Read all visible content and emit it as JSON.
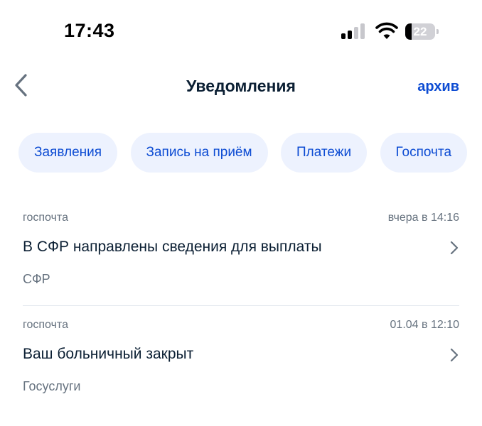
{
  "status_bar": {
    "time": "17:43",
    "battery": "22",
    "battery_level": 0.22,
    "icons": [
      "signal-icon",
      "wifi-icon",
      "battery-icon"
    ]
  },
  "header": {
    "title": "Уведомления",
    "archive_label": "архив",
    "back_icon": "chevron-left-icon"
  },
  "filters": [
    {
      "label": "Заявления"
    },
    {
      "label": "Запись на приём"
    },
    {
      "label": "Платежи"
    },
    {
      "label": "Госпочта"
    }
  ],
  "notifications": [
    {
      "category": "госпочта",
      "time": "вчера в 14:16",
      "title": "В СФР направлены сведения для выплаты",
      "sender": "СФР"
    },
    {
      "category": "госпочта",
      "time": "01.04 в 12:10",
      "title": "Ваш больничный закрыт",
      "sender": "Госуслуги"
    }
  ],
  "colors": {
    "accent": "#0d4cd3",
    "chip_background": "#edf2fe",
    "text_primary": "#0b1f33",
    "text_secondary": "#66727f",
    "divider": "#e3e8ee"
  }
}
